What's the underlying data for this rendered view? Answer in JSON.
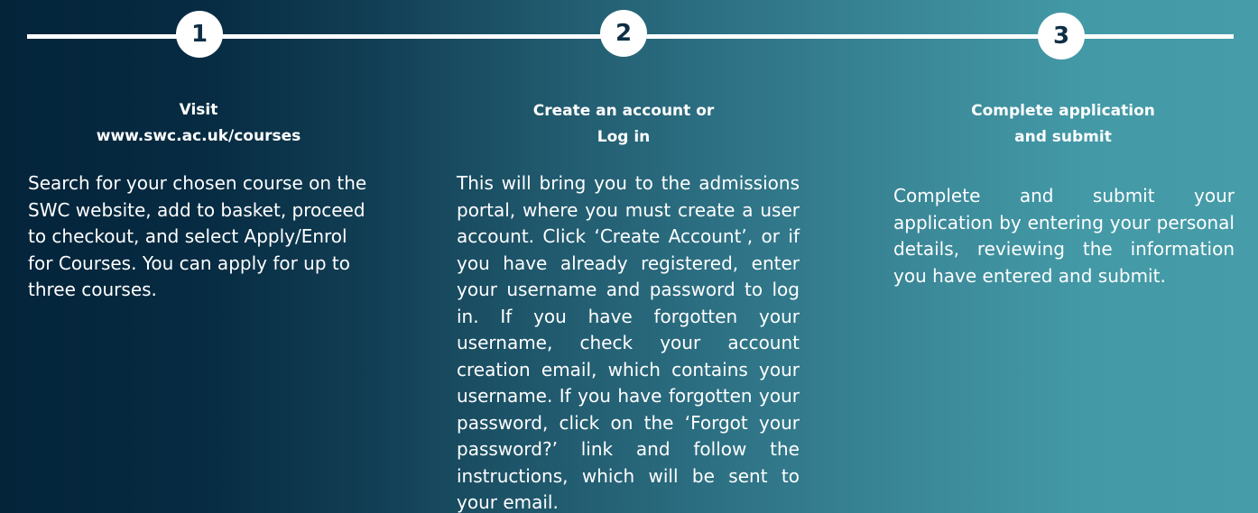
{
  "steps": [
    {
      "number": "1",
      "title_line1": "Visit",
      "title_line2": "www.swc.ac.uk/courses",
      "body": "Search for your chosen course on the SWC website, add to basket, proceed to checkout, and select Apply/Enrol for Courses. You can apply for up to three courses."
    },
    {
      "number": "2",
      "title_line1": "Create an account or",
      "title_line2": "Log in",
      "body": "This will bring you to the admissions portal, where you must create a user account. Click ‘Create Account’, or if you have already registered, enter your username and password to log in.  If you have forgotten your username, check your account creation email, which contains your username. If you have forgotten your password, click on the ‘Forgot your password?’ link and follow the instructions, which will be sent to your email."
    },
    {
      "number": "3",
      "title_line1": "Complete application",
      "title_line2": "and submit",
      "body": "Complete and submit your application by entering your personal details, reviewing the information you have entered and submit."
    }
  ],
  "colors": {
    "gradient_start": "#04243a",
    "gradient_end": "#469ca8",
    "circle_text": "#0e2f45"
  }
}
